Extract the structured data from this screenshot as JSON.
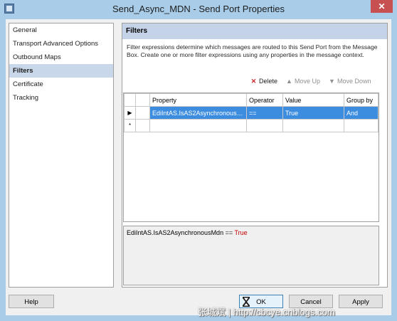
{
  "window": {
    "title": "Send_Async_MDN - Send Port Properties",
    "close_glyph": "✕"
  },
  "nav": {
    "items": [
      {
        "label": "General"
      },
      {
        "label": "Transport Advanced Options"
      },
      {
        "label": "Outbound Maps"
      },
      {
        "label": "Filters"
      },
      {
        "label": "Certificate"
      },
      {
        "label": "Tracking"
      }
    ],
    "selected": "Filters"
  },
  "panel": {
    "header": "Filters",
    "description": "Filter expressions determine which messages are routed to this Send Port from the Message Box. Create one or more filter expressions using any properties in the message context."
  },
  "toolbar": {
    "delete_label": "Delete",
    "move_up_label": "Move Up",
    "move_down_label": "Move Down"
  },
  "grid": {
    "columns": [
      "Property",
      "Operator",
      "Value",
      "Group by"
    ],
    "rows": [
      {
        "marker": "▶",
        "property": "EdiIntAS.IsAS2AsynchronousMdn",
        "operator": "==",
        "value": "True",
        "group_by": "And"
      }
    ],
    "new_row_marker": "*"
  },
  "expression": {
    "property": "EdiIntAS.IsAS2AsynchronousMdn",
    "operator": "==",
    "value": "True"
  },
  "buttons": {
    "help": "Help",
    "ok": "OK",
    "cancel": "Cancel",
    "apply": "Apply"
  },
  "watermark": "张城斌 | http://cbcye.cnblogs.com"
}
